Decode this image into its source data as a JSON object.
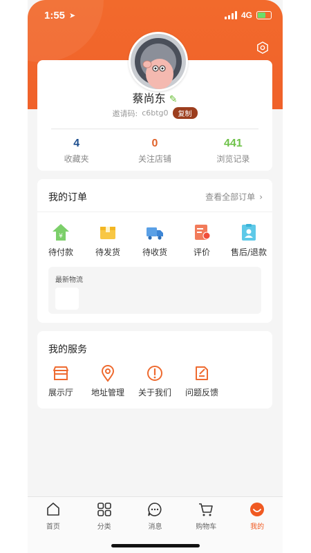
{
  "status_bar": {
    "time": "1:55",
    "network": "4G"
  },
  "profile": {
    "name": "蔡尚东",
    "invite_label": "邀请码:",
    "invite_code": "c6btg0",
    "copy_label": "复制",
    "stats": [
      {
        "value": "4",
        "label": "收藏夹",
        "color": "#1e4f8f"
      },
      {
        "value": "0",
        "label": "关注店铺",
        "color": "#e0622a"
      },
      {
        "value": "441",
        "label": "浏览记录",
        "color": "#6fc24a"
      }
    ]
  },
  "orders": {
    "title": "我的订单",
    "view_all": "查看全部订单",
    "items": [
      {
        "label": "待付款",
        "icon": "pending-payment-icon"
      },
      {
        "label": "待发货",
        "icon": "pending-shipment-icon"
      },
      {
        "label": "待收货",
        "icon": "delivery-truck-icon"
      },
      {
        "label": "评价",
        "icon": "review-icon"
      },
      {
        "label": "售后/退款",
        "icon": "after-sales-icon"
      }
    ],
    "logistics_title": "最新物流"
  },
  "services": {
    "title": "我的服务",
    "items": [
      {
        "label": "展示厅",
        "icon": "showroom-icon"
      },
      {
        "label": "地址管理",
        "icon": "location-pin-icon"
      },
      {
        "label": "关于我们",
        "icon": "info-icon"
      },
      {
        "label": "问题反馈",
        "icon": "feedback-icon"
      }
    ]
  },
  "tabbar": {
    "tabs": [
      {
        "label": "首页",
        "icon": "home-icon"
      },
      {
        "label": "分类",
        "icon": "category-grid-icon"
      },
      {
        "label": "消息",
        "icon": "message-icon"
      },
      {
        "label": "购物车",
        "icon": "cart-icon"
      },
      {
        "label": "我的",
        "icon": "profile-icon",
        "active": true
      }
    ]
  },
  "colors": {
    "brand": "#f0612a",
    "active_tab": "#f05a22"
  }
}
